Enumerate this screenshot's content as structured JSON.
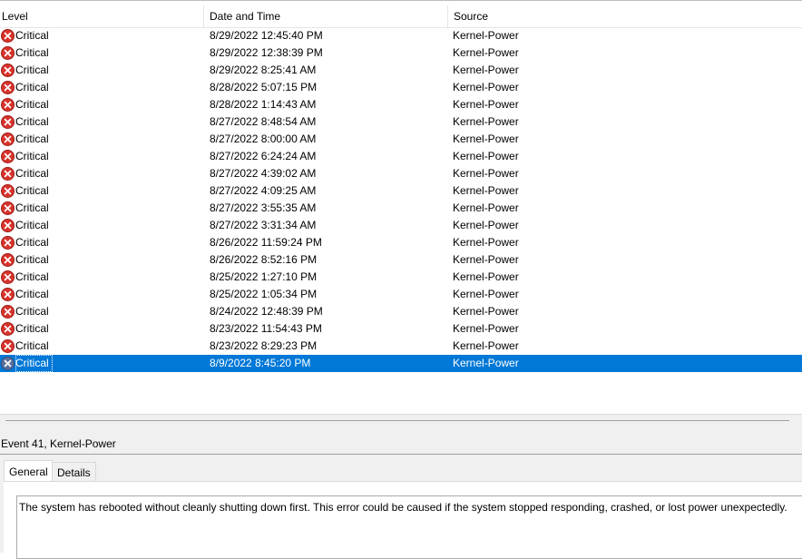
{
  "columns": {
    "level": "Level",
    "datetime": "Date and Time",
    "source": "Source"
  },
  "colors": {
    "selection": "#0078d7",
    "critical_icon": "#d8342c"
  },
  "rows": [
    {
      "level": "Critical",
      "datetime": "8/29/2022 12:45:40 PM",
      "source": "Kernel-Power"
    },
    {
      "level": "Critical",
      "datetime": "8/29/2022 12:38:39 PM",
      "source": "Kernel-Power"
    },
    {
      "level": "Critical",
      "datetime": "8/29/2022 8:25:41 AM",
      "source": "Kernel-Power"
    },
    {
      "level": "Critical",
      "datetime": "8/28/2022 5:07:15 PM",
      "source": "Kernel-Power"
    },
    {
      "level": "Critical",
      "datetime": "8/28/2022 1:14:43 AM",
      "source": "Kernel-Power"
    },
    {
      "level": "Critical",
      "datetime": "8/27/2022 8:48:54 AM",
      "source": "Kernel-Power"
    },
    {
      "level": "Critical",
      "datetime": "8/27/2022 8:00:00 AM",
      "source": "Kernel-Power"
    },
    {
      "level": "Critical",
      "datetime": "8/27/2022 6:24:24 AM",
      "source": "Kernel-Power"
    },
    {
      "level": "Critical",
      "datetime": "8/27/2022 4:39:02 AM",
      "source": "Kernel-Power"
    },
    {
      "level": "Critical",
      "datetime": "8/27/2022 4:09:25 AM",
      "source": "Kernel-Power"
    },
    {
      "level": "Critical",
      "datetime": "8/27/2022 3:55:35 AM",
      "source": "Kernel-Power"
    },
    {
      "level": "Critical",
      "datetime": "8/27/2022 3:31:34 AM",
      "source": "Kernel-Power"
    },
    {
      "level": "Critical",
      "datetime": "8/26/2022 11:59:24 PM",
      "source": "Kernel-Power"
    },
    {
      "level": "Critical",
      "datetime": "8/26/2022 8:52:16 PM",
      "source": "Kernel-Power"
    },
    {
      "level": "Critical",
      "datetime": "8/25/2022 1:27:10 PM",
      "source": "Kernel-Power"
    },
    {
      "level": "Critical",
      "datetime": "8/25/2022 1:05:34 PM",
      "source": "Kernel-Power"
    },
    {
      "level": "Critical",
      "datetime": "8/24/2022 12:48:39 PM",
      "source": "Kernel-Power"
    },
    {
      "level": "Critical",
      "datetime": "8/23/2022 11:54:43 PM",
      "source": "Kernel-Power"
    },
    {
      "level": "Critical",
      "datetime": "8/23/2022 8:29:23 PM",
      "source": "Kernel-Power"
    },
    {
      "level": "Critical",
      "datetime": "8/9/2022 8:45:20 PM",
      "source": "Kernel-Power",
      "selected": true
    }
  ],
  "event": {
    "title": "Event 41, Kernel-Power",
    "tabs": [
      "General",
      "Details"
    ],
    "description": "The system has rebooted without cleanly shutting down first. This error could be caused if the system stopped responding, crashed, or lost power unexpectedly."
  }
}
